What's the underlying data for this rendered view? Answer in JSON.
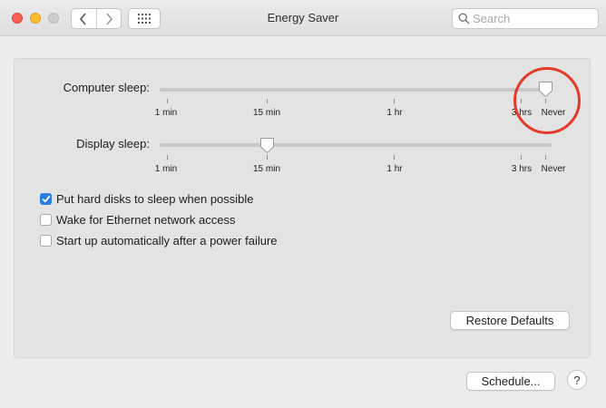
{
  "window": {
    "title": "Energy Saver",
    "traffic_lights": [
      "close",
      "minimize",
      "zoom"
    ],
    "nav_icons": [
      "chevron-left-icon",
      "chevron-right-icon",
      "grid-icon"
    ]
  },
  "search": {
    "placeholder": "Search",
    "value": ""
  },
  "computer_sleep": {
    "label": "Computer sleep:",
    "value": "Never",
    "tick_labels": [
      "1 min",
      "15 min",
      "1 hr",
      "3 hrs",
      "Never"
    ]
  },
  "display_sleep": {
    "label": "Display sleep:",
    "value": "15 min",
    "tick_labels": [
      "1 min",
      "15 min",
      "1 hr",
      "3 hrs",
      "Never"
    ]
  },
  "options": [
    {
      "label": "Put hard disks to sleep when possible",
      "checked": true
    },
    {
      "label": "Wake for Ethernet network access",
      "checked": false
    },
    {
      "label": "Start up automatically after a power failure",
      "checked": false
    }
  ],
  "buttons": {
    "restore_defaults": "Restore Defaults",
    "schedule": "Schedule...",
    "help": "?"
  },
  "colors": {
    "accent": "#2a7de1",
    "annotation": "#e53a2a"
  }
}
